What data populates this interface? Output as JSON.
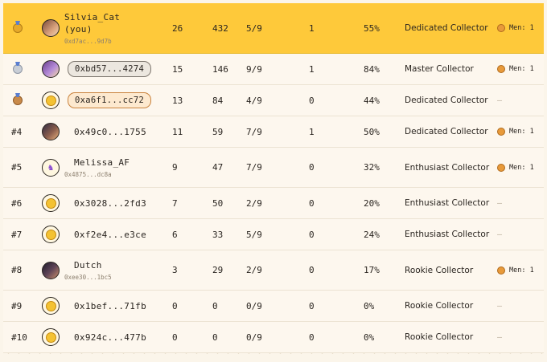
{
  "rows": [
    {
      "rank": "",
      "medal": "gold",
      "avatar": "photo",
      "name": "Silvia_Cat",
      "you": "(you)",
      "address": "0xd7ac...9d7b",
      "a": "26",
      "b": "432",
      "c": "5/9",
      "d": "1",
      "e": "55%",
      "level": "Dedicated Collector",
      "men": "Men: 1"
    },
    {
      "rank": "",
      "medal": "silver",
      "avatar": "photo2",
      "name": "",
      "pill": "0xbd57...4274",
      "pillStyle": "grey",
      "a": "15",
      "b": "146",
      "c": "9/9",
      "d": "1",
      "e": "84%",
      "level": "Master Collector",
      "men": "Men: 1"
    },
    {
      "rank": "",
      "medal": "bronze",
      "avatar": "coin",
      "name": "",
      "pill": "0xa6f1...cc72",
      "pillStyle": "orange",
      "a": "13",
      "b": "84",
      "c": "4/9",
      "d": "0",
      "e": "44%",
      "level": "Dedicated Collector",
      "men": "—"
    },
    {
      "rank": "#4",
      "avatar": "photo3",
      "name": "0x49c0...1755",
      "a": "11",
      "b": "59",
      "c": "7/9",
      "d": "1",
      "e": "50%",
      "level": "Dedicated Collector",
      "men": "Men: 1"
    },
    {
      "rank": "#5",
      "avatar": "unicorn",
      "name": "Melissa_AF",
      "address": "0x4875...dc8a",
      "a": "9",
      "b": "47",
      "c": "7/9",
      "d": "0",
      "e": "32%",
      "level": "Enthusiast Collector",
      "men": "Men: 1"
    },
    {
      "rank": "#6",
      "avatar": "coin",
      "name": "0x3028...2fd3",
      "a": "7",
      "b": "50",
      "c": "2/9",
      "d": "0",
      "e": "20%",
      "level": "Enthusiast Collector",
      "men": "—"
    },
    {
      "rank": "#7",
      "avatar": "coin",
      "name": "0xf2e4...e3ce",
      "a": "6",
      "b": "33",
      "c": "5/9",
      "d": "0",
      "e": "24%",
      "level": "Enthusiast Collector",
      "men": "—"
    },
    {
      "rank": "#8",
      "avatar": "photo4",
      "name": "Dutch",
      "address": "0xee30...1bc5",
      "a": "3",
      "b": "29",
      "c": "2/9",
      "d": "0",
      "e": "17%",
      "level": "Rookie Collector",
      "men": "Men: 1"
    },
    {
      "rank": "#9",
      "avatar": "coin",
      "name": "0x1bef...71fb",
      "a": "0",
      "b": "0",
      "c": "0/9",
      "d": "0",
      "e": "0%",
      "level": "Rookie Collector",
      "men": "—"
    },
    {
      "rank": "#10",
      "avatar": "coin",
      "name": "0x924c...477b",
      "a": "0",
      "b": "0",
      "c": "0/9",
      "d": "0",
      "e": "0%",
      "level": "Rookie Collector",
      "men": "—"
    }
  ],
  "colors": {
    "you_row": "#fec93a",
    "background": "#fbf5ea"
  }
}
